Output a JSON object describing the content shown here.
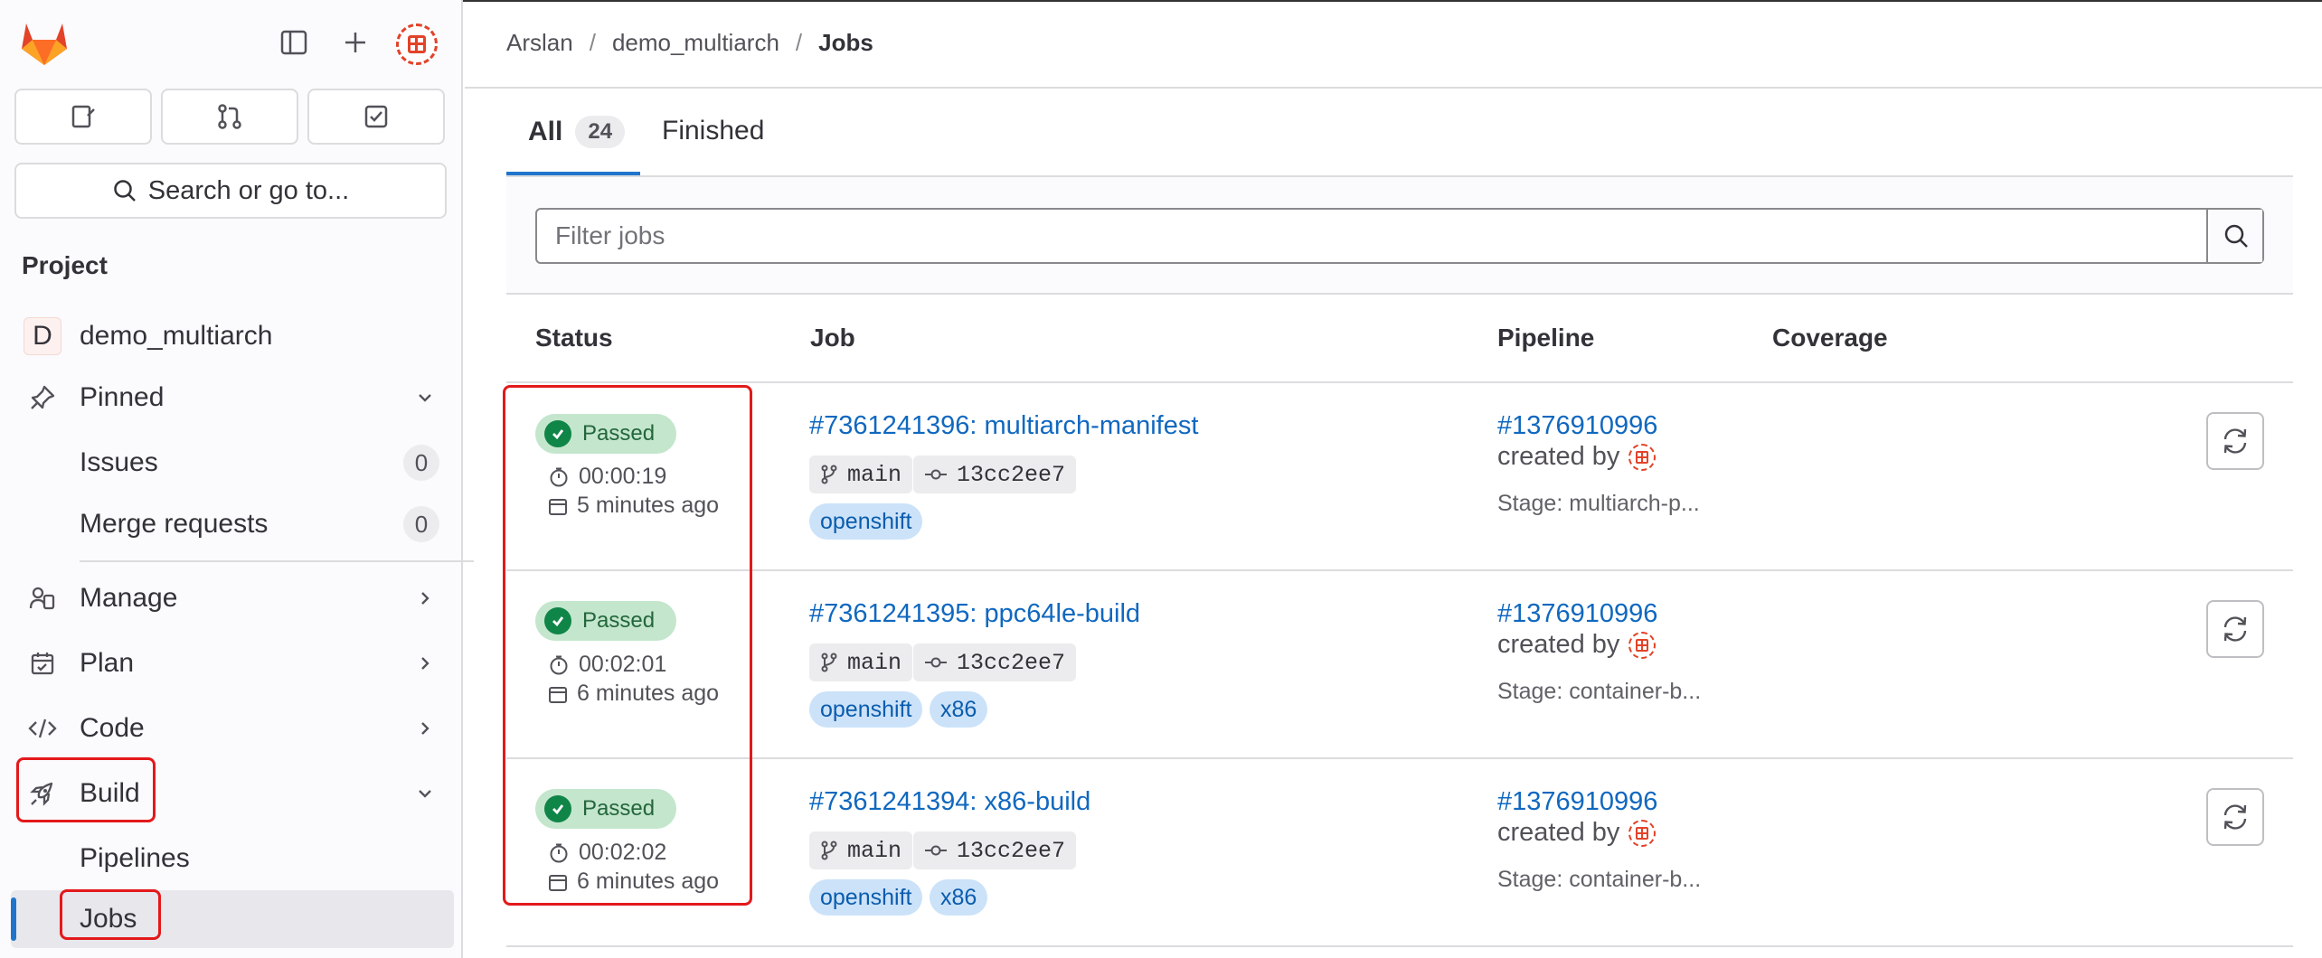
{
  "header": {
    "breadcrumb": [
      "Arslan",
      "demo_multiarch",
      "Jobs"
    ]
  },
  "sidebar": {
    "search_label": "Search or go to...",
    "section_title": "Project",
    "project": {
      "initial": "D",
      "name": "demo_multiarch"
    },
    "pinned_label": "Pinned",
    "pinned_items": [
      {
        "label": "Issues",
        "count": "0"
      },
      {
        "label": "Merge requests",
        "count": "0"
      }
    ],
    "nav": [
      {
        "label": "Manage",
        "icon": "users-icon"
      },
      {
        "label": "Plan",
        "icon": "calendar-icon"
      },
      {
        "label": "Code",
        "icon": "code-icon"
      },
      {
        "label": "Build",
        "icon": "rocket-icon"
      }
    ],
    "build_items": [
      "Pipelines",
      "Jobs"
    ]
  },
  "tabs": [
    {
      "label": "All",
      "count": "24"
    },
    {
      "label": "Finished"
    }
  ],
  "filter": {
    "placeholder": "Filter jobs"
  },
  "table": {
    "headers": [
      "Status",
      "Job",
      "Pipeline",
      "Coverage"
    ],
    "rows": [
      {
        "status": "Passed",
        "duration": "00:00:19",
        "finished": "5 minutes ago",
        "job": "#7361241396: multiarch-manifest",
        "ref": "main",
        "commit": "13cc2ee7",
        "tags": [
          "openshift"
        ],
        "pipeline": "#1376910996",
        "created_by": "created by",
        "stage": "Stage: multiarch-p..."
      },
      {
        "status": "Passed",
        "duration": "00:02:01",
        "finished": "6 minutes ago",
        "job": "#7361241395: ppc64le-build",
        "ref": "main",
        "commit": "13cc2ee7",
        "tags": [
          "openshift",
          "x86"
        ],
        "pipeline": "#1376910996",
        "created_by": "created by",
        "stage": "Stage: container-b..."
      },
      {
        "status": "Passed",
        "duration": "00:02:02",
        "finished": "6 minutes ago",
        "job": "#7361241394: x86-build",
        "ref": "main",
        "commit": "13cc2ee7",
        "tags": [
          "openshift",
          "x86"
        ],
        "pipeline": "#1376910996",
        "created_by": "created by",
        "stage": "Stage: container-b..."
      }
    ]
  },
  "colors": {
    "accent": "#1f75cb",
    "link": "#1068bf",
    "passed_bg": "#c3e6cd",
    "passed_icon": "#108548",
    "highlight": "#e3191b"
  }
}
